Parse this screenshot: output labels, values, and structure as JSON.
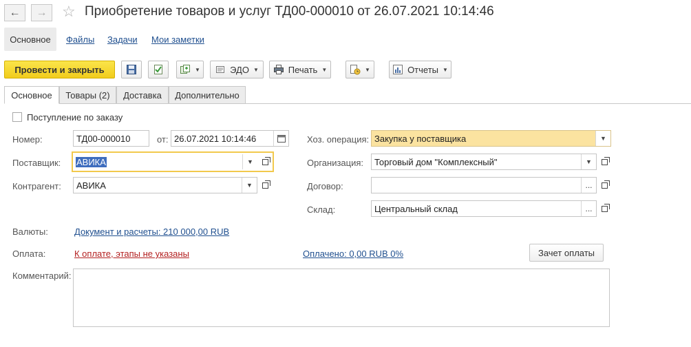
{
  "window": {
    "title": "Приобретение товаров и услуг ТД00-000010 от 26.07.2021 10:14:46",
    "back_icon": "arrow-left-icon",
    "forward_icon": "arrow-right-icon",
    "favorite_icon": "star-icon"
  },
  "sections": {
    "active": "Основное",
    "links": [
      "Файлы",
      "Задачи",
      "Мои заметки"
    ]
  },
  "toolbar": {
    "post_close_label": "Провести и закрыть",
    "edo_label": "ЭДО",
    "print_label": "Печать",
    "reports_label": "Отчеты",
    "accent_color": "#f5d52b"
  },
  "tabs": [
    {
      "label": "Основное",
      "active": true
    },
    {
      "label": "Товары (2)",
      "active": false
    },
    {
      "label": "Доставка",
      "active": false
    },
    {
      "label": "Дополнительно",
      "active": false
    }
  ],
  "form": {
    "order_checkbox_label": "Поступление по заказу",
    "order_checkbox_checked": false,
    "number_label": "Номер:",
    "number_value": "ТД00-000010",
    "date_label": "от:",
    "date_value": "26.07.2021 10:14:46",
    "supplier_label": "Поставщик:",
    "supplier_value": "АВИКА",
    "counterparty_label": "Контрагент:",
    "counterparty_value": "АВИКА",
    "operation_label": "Хоз. операция:",
    "operation_value": "Закупка у поставщика",
    "organization_label": "Организация:",
    "organization_value": "Торговый дом \"Комплексный\"",
    "contract_label": "Договор:",
    "contract_value": "",
    "warehouse_label": "Склад:",
    "warehouse_value": "Центральный склад",
    "currency_label": "Валюты:",
    "currency_link": "Документ и расчеты: 210 000,00 RUB",
    "payment_label": "Оплата:",
    "payment_link": "К оплате, этапы не указаны",
    "paid_link": "Оплачено: 0,00 RUB 0%",
    "offset_button": "Зачет оплаты",
    "comment_label": "Комментарий:",
    "comment_value": ""
  }
}
